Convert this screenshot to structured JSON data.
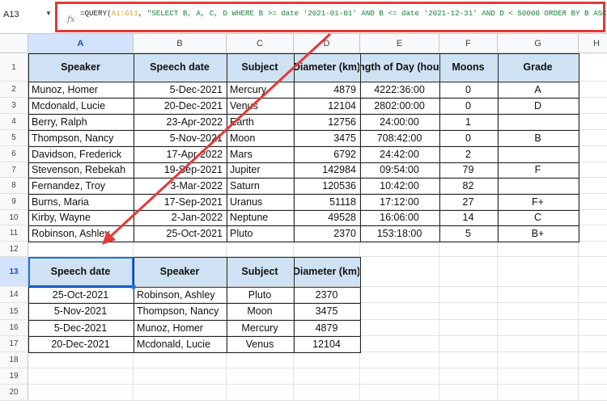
{
  "name_box": "A13",
  "formula": {
    "prefix": "=QUERY(",
    "range": "A1:G11",
    "sep": ", ",
    "query": "\"SELECT B, A, C, D WHERE B >= date '2021-01-01' AND B <= date '2021-12-31' AND D < 50000 ORDER BY B ASC\"",
    "suffix": ")"
  },
  "columns": [
    "A",
    "B",
    "C",
    "D",
    "E",
    "F",
    "G",
    "H"
  ],
  "rows": [
    "1",
    "2",
    "3",
    "4",
    "5",
    "6",
    "7",
    "8",
    "9",
    "10",
    "11",
    "12",
    "13",
    "14",
    "15",
    "16",
    "17",
    "18",
    "19",
    "20"
  ],
  "selected_cell": "A13",
  "source_table": {
    "headers": [
      "Speaker",
      "Speech date",
      "Subject",
      "Diameter (km)",
      "Length of Day (hours)",
      "Moons",
      "Grade"
    ],
    "rows": [
      [
        "Munoz, Homer",
        "5-Dec-2021",
        "Mercury",
        "4879",
        "4222:36:00",
        "0",
        "A"
      ],
      [
        "Mcdonald, Lucie",
        "20-Dec-2021",
        "Venus",
        "12104",
        "2802:00:00",
        "0",
        "D"
      ],
      [
        "Berry, Ralph",
        "23-Apr-2022",
        "Earth",
        "12756",
        "24:00:00",
        "1",
        ""
      ],
      [
        "Thompson, Nancy",
        "5-Nov-2021",
        "Moon",
        "3475",
        "708:42:00",
        "0",
        "B"
      ],
      [
        "Davidson, Frederick",
        "17-Apr-2022",
        "Mars",
        "6792",
        "24:42:00",
        "2",
        ""
      ],
      [
        "Stevenson, Rebekah",
        "19-Sep-2021",
        "Jupiter",
        "142984",
        "09:54:00",
        "79",
        "F"
      ],
      [
        "Fernandez, Troy",
        "3-Mar-2022",
        "Saturn",
        "120536",
        "10:42:00",
        "82",
        ""
      ],
      [
        "Burns, Maria",
        "17-Sep-2021",
        "Uranus",
        "51118",
        "17:12:00",
        "27",
        "F+"
      ],
      [
        "Kirby, Wayne",
        "2-Jan-2022",
        "Neptune",
        "49528",
        "16:06:00",
        "14",
        "C"
      ],
      [
        "Robinson, Ashley",
        "25-Oct-2021",
        "Pluto",
        "2370",
        "153:18:00",
        "5",
        "B+"
      ]
    ]
  },
  "result_table": {
    "headers": [
      "Speech date",
      "Speaker",
      "Subject",
      "Diameter (km)"
    ],
    "rows": [
      [
        "25-Oct-2021",
        "Robinson, Ashley",
        "Pluto",
        "2370"
      ],
      [
        "5-Nov-2021",
        "Thompson, Nancy",
        "Moon",
        "3475"
      ],
      [
        "5-Dec-2021",
        "Munoz, Homer",
        "Mercury",
        "4879"
      ],
      [
        "20-Dec-2021",
        "Mcdonald, Lucie",
        "Venus",
        "12104"
      ]
    ]
  },
  "colors": {
    "highlight": "#e53935",
    "header_fill": "#cfe2f3",
    "range_ref": "#d7a21f",
    "string": "#188038"
  }
}
